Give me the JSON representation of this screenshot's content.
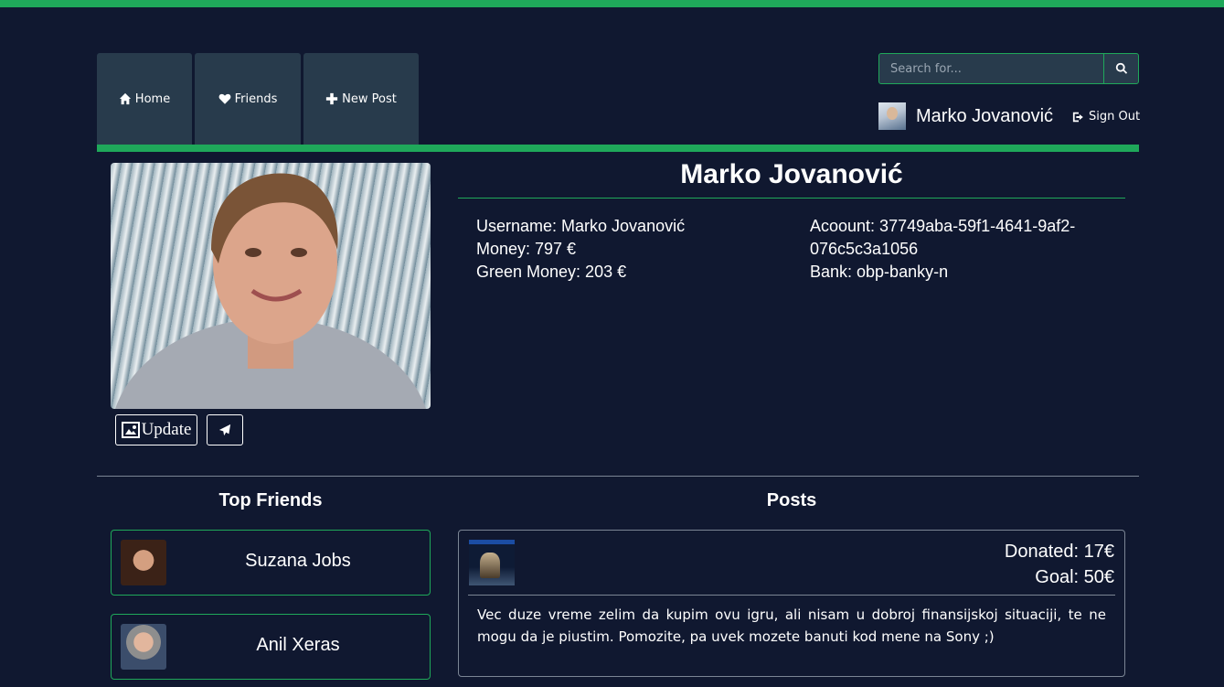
{
  "nav": {
    "home_label": "Home",
    "friends_label": "Friends",
    "new_post_label": "New Post"
  },
  "search": {
    "placeholder": "Search for..."
  },
  "user": {
    "name": "Marko Jovanović",
    "sign_out_label": "Sign Out"
  },
  "profile": {
    "title": "Marko Jovanović",
    "update_label": "Update",
    "username": "Username: Marko Jovanović",
    "money": "Money: 797 €",
    "green_money": "Green Money: 203 €",
    "account": "Acoount: 37749aba-59f1-4641-9af2-076c5c3a1056",
    "bank": "Bank: obp-banky-n"
  },
  "friends": {
    "title": "Top Friends",
    "items": [
      {
        "name": "Suzana Jobs"
      },
      {
        "name": "Anil Xeras"
      }
    ]
  },
  "posts": {
    "title": "Posts",
    "items": [
      {
        "donated": "Donated: 17€",
        "goal": "Goal: 50€",
        "text": "Vec duze vreme zelim da kupim ovu igru, ali nisam u dobroj finansijskoj situaciji, te ne mogu da je piustim. Pomozite, pa uvek mozete banuti kod mene na Sony ;)"
      }
    ]
  },
  "colors": {
    "accent": "#1fa85a",
    "background": "#101830",
    "nav_bg": "#283b4c"
  },
  "icons": [
    "home-icon",
    "heart-icon",
    "plus-icon",
    "search-icon",
    "sign-out-icon",
    "image-icon",
    "send-icon"
  ]
}
